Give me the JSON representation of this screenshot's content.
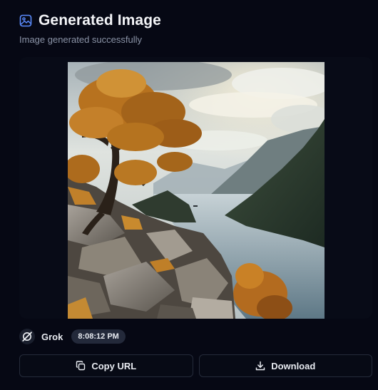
{
  "header": {
    "icon": "image-icon",
    "title": "Generated Image",
    "subtitle": "Image generated successfully"
  },
  "image": {
    "description_icon": "generated-landscape-image"
  },
  "meta": {
    "model_icon": "grok-logo-icon",
    "model_name": "Grok",
    "timestamp": "8:08:12 PM"
  },
  "actions": {
    "copy_label": "Copy URL",
    "copy_icon": "copy-icon",
    "download_label": "Download",
    "download_icon": "download-icon"
  },
  "colors": {
    "background": "#060814",
    "accent": "#5b8cff",
    "badge": "#23293a",
    "button_border": "#252b3a"
  }
}
